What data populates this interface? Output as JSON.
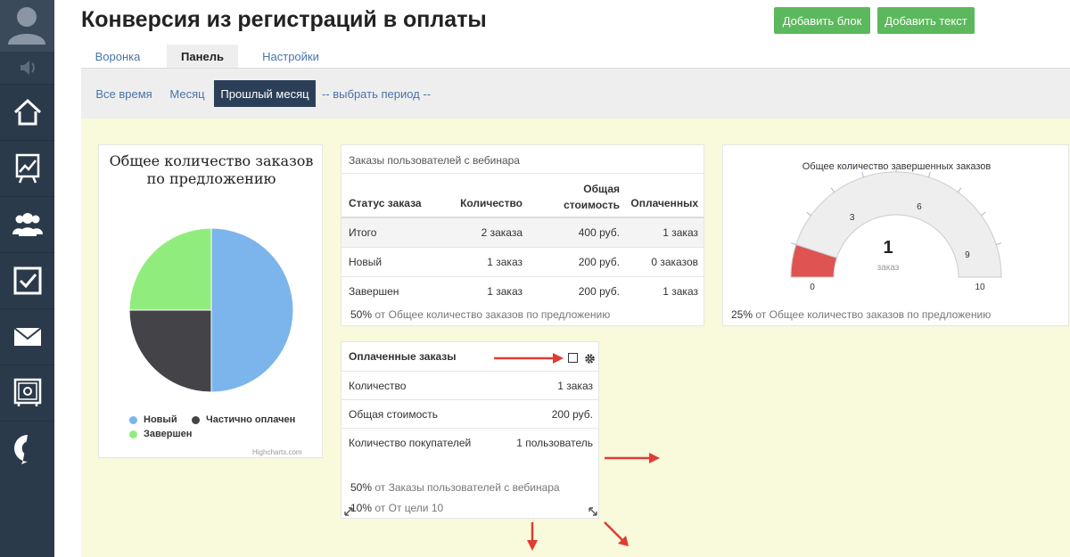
{
  "header": {
    "title": "Конверсия из регистраций в оплаты",
    "add_block_label": "Добавить блок",
    "add_text_label": "Добавить текст"
  },
  "tabs": [
    {
      "label": "Воронка",
      "active": false
    },
    {
      "label": "Панель",
      "active": true
    },
    {
      "label": "Настройки",
      "active": false
    }
  ],
  "periods": [
    {
      "label": "Все время",
      "active": false
    },
    {
      "label": "Месяц",
      "active": false
    },
    {
      "label": "Прошлый месяц",
      "active": true
    },
    {
      "label": "-- выбрать период --",
      "active": false
    }
  ],
  "sidebar": {
    "items": [
      "avatar-icon",
      "speaker-icon",
      "home-icon",
      "chart-icon",
      "users-icon",
      "checkbox-icon",
      "mail-icon",
      "safe-icon",
      "logo-icon"
    ]
  },
  "pie_card": {
    "title": "Общее количество заказов по предложению",
    "credit": "Highcharts.com",
    "chart_data": {
      "type": "pie",
      "series": [
        {
          "name": "Новый",
          "value": 50,
          "color": "#7cb5ec"
        },
        {
          "name": "Частично оплачен",
          "value": 25,
          "color": "#434348"
        },
        {
          "name": "Завершен",
          "value": 25,
          "color": "#90ed7d"
        }
      ]
    }
  },
  "orders_card": {
    "title": "Заказы пользователей с вебинара",
    "columns": [
      "Статус заказа",
      "Количество",
      "Общая стоимость",
      "Оплаченных"
    ],
    "rows": [
      [
        "Итого",
        "2 заказа",
        "400 руб.",
        "1 заказ"
      ],
      [
        "Новый",
        "1 заказ",
        "200 руб.",
        "0 заказов"
      ],
      [
        "Завершен",
        "1 заказ",
        "200 руб.",
        "1 заказ"
      ]
    ],
    "footer_pct": "50%",
    "footer_text": "от Общее количество заказов по предложению"
  },
  "gauge_card": {
    "title": "Общее количество завершенных заказов",
    "value": "1",
    "unit": "заказ",
    "ticks": [
      "0",
      "3",
      "6",
      "9",
      "10"
    ],
    "min": 0,
    "max": 10,
    "level": 1,
    "band_color": "#df5353",
    "footer_pct": "25%",
    "footer_text": "от Общее количество заказов по предложению"
  },
  "paid_card": {
    "title": "Оплаченные заказы",
    "rows": [
      [
        "Количество",
        "1 заказ"
      ],
      [
        "Общая стоимость",
        "200 руб."
      ],
      [
        "Количество покупателей",
        "1 пользователь"
      ]
    ],
    "footer1_pct": "50%",
    "footer1_text": "от Заказы пользователей с вебинара",
    "footer2_pct": "10%",
    "footer2_text": "от От цели 10"
  },
  "colors": {
    "accent_green": "#5cb85c",
    "active_period": "#2b4058",
    "sidebar": "#2b3a4a",
    "annotation_arrow": "#e03c31"
  }
}
